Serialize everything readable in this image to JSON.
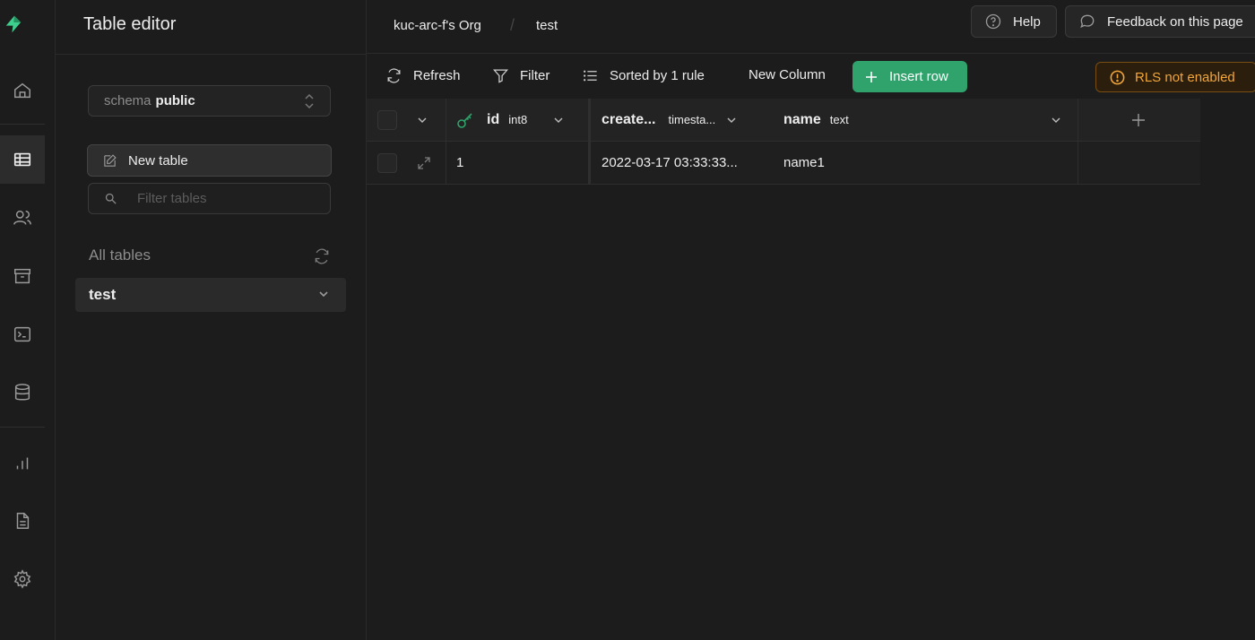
{
  "app": {
    "title": "Table editor"
  },
  "breadcrumb": {
    "org": "kuc-arc-f's Org",
    "project": "test"
  },
  "header": {
    "help_label": "Help",
    "feedback_label": "Feedback on this page"
  },
  "rail": {
    "items": [
      "home-icon",
      "table-editor-icon",
      "users-icon",
      "storage-icon",
      "sql-editor-icon",
      "database-icon",
      "reports-icon",
      "docs-icon",
      "settings-icon"
    ],
    "active": "table-editor-icon",
    "brand_color": "#3ecf8e"
  },
  "sidebar": {
    "schema_prefix": "schema",
    "schema_value": "public",
    "new_table_label": "New table",
    "filter_placeholder": "Filter tables",
    "all_tables_label": "All tables",
    "tables": [
      {
        "name": "test"
      }
    ]
  },
  "toolbar": {
    "refresh_label": "Refresh",
    "filter_label": "Filter",
    "sort_label": "Sorted by 1 rule",
    "new_column_label": "New Column",
    "insert_row_label": "Insert row",
    "rls_label": "RLS not enabled",
    "accent_green": "#2fa36b",
    "warning_color": "#f2a53a"
  },
  "grid": {
    "columns": [
      {
        "name": "id",
        "type": "int8",
        "primary_key": true
      },
      {
        "name": "create...",
        "type": "timesta..."
      },
      {
        "name": "name",
        "type": "text"
      }
    ],
    "rows": [
      {
        "id": "1",
        "created_at": "2022-03-17 03:33:33...",
        "name": "name1"
      }
    ]
  }
}
